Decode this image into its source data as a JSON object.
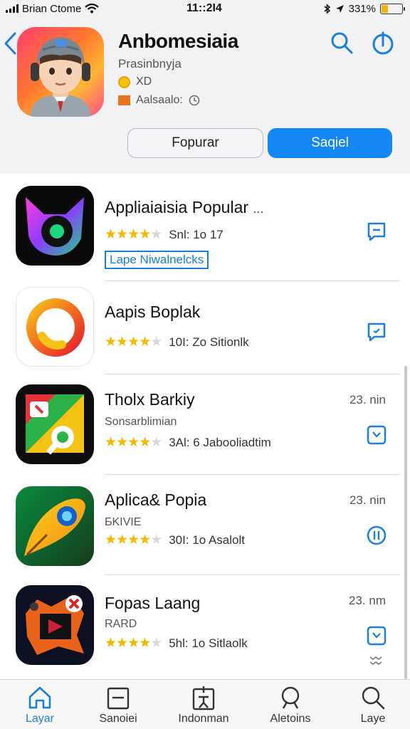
{
  "status_bar": {
    "carrier": "Brian Ctome",
    "time": "11::2I4",
    "battery": "331%",
    "battery_level": 0.33
  },
  "header": {
    "title": "Anbomesiaia",
    "subtitle": "Prasinbnyja",
    "meta1": "XD",
    "meta2": "Aalsaalo:",
    "tab_popular": "Fopurar",
    "tab_search": "Saqiel"
  },
  "apps": [
    {
      "title": "Appliaiaisia Popular",
      "more": "...",
      "rating_text": "Snl:  1o  17",
      "tag": "Lape Niwalnelcks",
      "action_icon": "message-icon"
    },
    {
      "title": "Aapis Boplak",
      "rating_text": "10I:  Zo  Sitionlk",
      "action_icon": "chat-icon"
    },
    {
      "title": "Tholx Barkiy",
      "subtitle": "Sonsarblimian",
      "rating_text": "3Al:  6   Jabooliadtim",
      "time": "23. nin",
      "action_icon": "clock-icon"
    },
    {
      "title": "Aplica& Popia",
      "subtitle": "ƂKIVIE",
      "rating_text": "30I:  1o  Asalolt",
      "time": "23. nin",
      "action_icon": "pause-icon"
    },
    {
      "title": "Fopas Laang",
      "subtitle": "RARD",
      "rating_text": "5hl:  1o  Sitlaolk",
      "time": "23. nm",
      "action_icon": "clock-icon"
    }
  ],
  "bottom_nav": [
    {
      "label": "Layar",
      "icon": "home-icon",
      "active": true
    },
    {
      "label": "Sanoiei",
      "icon": "document-icon",
      "active": false
    },
    {
      "label": "Indonman",
      "icon": "person-icon",
      "active": false
    },
    {
      "label": "Aletoins",
      "icon": "search-icon",
      "active": false
    },
    {
      "label": "Laye",
      "icon": "search-icon",
      "active": false
    }
  ],
  "colors": {
    "accent": "#1587f5",
    "star": "#f5b800"
  }
}
